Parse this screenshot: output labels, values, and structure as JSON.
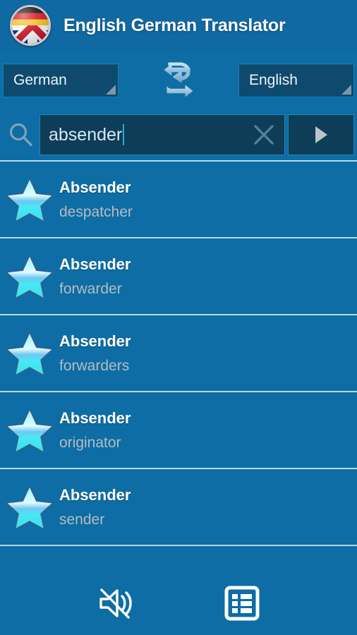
{
  "header": {
    "title": "English German Translator",
    "app_icon": "german-uk-flag-globe-icon"
  },
  "language_bar": {
    "source_language": "German",
    "target_language": "English",
    "swap_icon": "swap-arrows-icon",
    "dropdown_indicator": "spinner-triangle-icon"
  },
  "search_bar": {
    "search_icon": "search-icon",
    "query": "absender",
    "placeholder": "",
    "clear_icon": "close-x-icon",
    "go_icon": "play-triangle-icon"
  },
  "results": [
    {
      "star_icon": "star-icon",
      "term": "Absender",
      "translation": "despatcher"
    },
    {
      "star_icon": "star-icon",
      "term": "Absender",
      "translation": "forwarder"
    },
    {
      "star_icon": "star-icon",
      "term": "Absender",
      "translation": "forwarders"
    },
    {
      "star_icon": "star-icon",
      "term": "Absender",
      "translation": "originator"
    },
    {
      "star_icon": "star-icon",
      "term": "Absender",
      "translation": "sender"
    }
  ],
  "bottom_bar": {
    "speaker_mute_icon": "speaker-mute-icon",
    "word_list_icon": "list-view-icon"
  },
  "colors": {
    "background": "#0d6da4",
    "header": "#1069a3",
    "field_dark": "#0d3d57",
    "spinner_dark": "#0d4a6e",
    "field_border": "#1f86bd",
    "divider": "#b9d8ea",
    "star": "#5ef0f5",
    "title_text": "#ffffff",
    "subtitle_text": "#b4bcc2"
  }
}
